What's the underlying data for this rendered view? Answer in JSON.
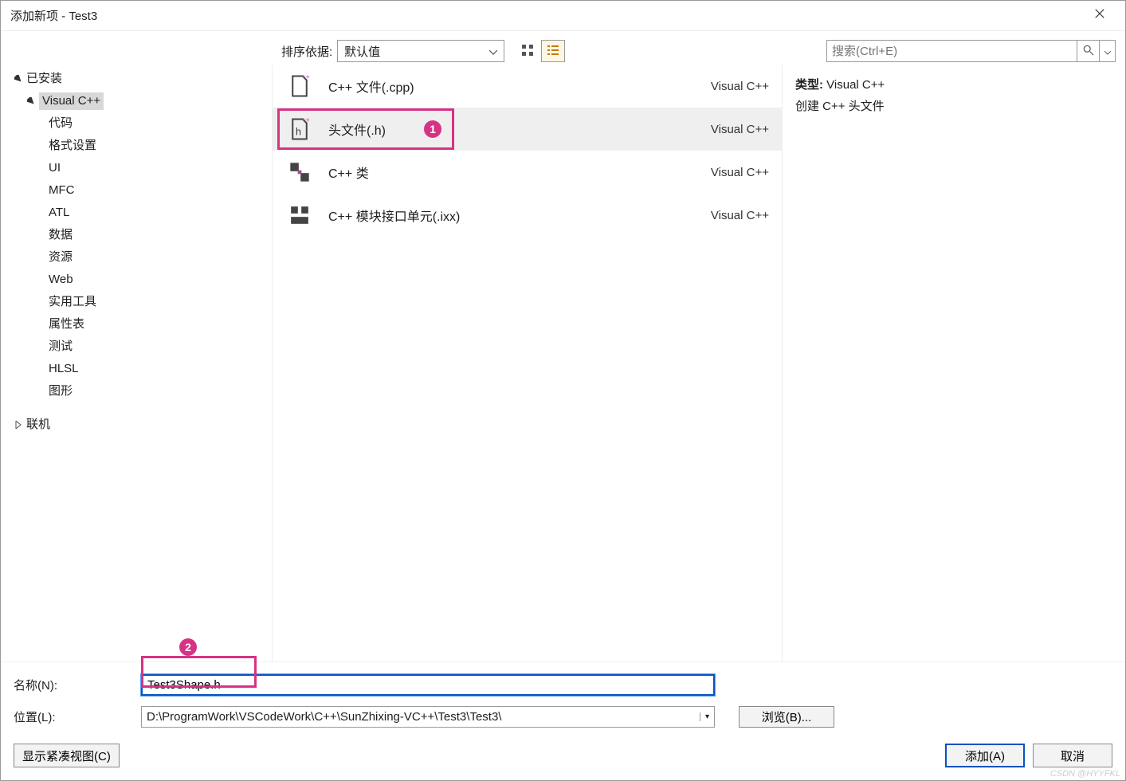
{
  "titlebar": {
    "title": "添加新项 - Test3"
  },
  "toprow": {
    "sort_label": "排序依据:",
    "sort_value": "默认值"
  },
  "search": {
    "placeholder": "搜索(Ctrl+E)"
  },
  "tree": {
    "installed": {
      "label": "已安装"
    },
    "visual_cpp": {
      "label": "Visual C++"
    },
    "items": [
      {
        "label": "代码"
      },
      {
        "label": "格式设置"
      },
      {
        "label": "UI"
      },
      {
        "label": "MFC"
      },
      {
        "label": "ATL"
      },
      {
        "label": "数据"
      },
      {
        "label": "资源"
      },
      {
        "label": "Web"
      },
      {
        "label": "实用工具"
      },
      {
        "label": "属性表"
      },
      {
        "label": "测试"
      },
      {
        "label": "HLSL"
      },
      {
        "label": "图形"
      }
    ],
    "online": {
      "label": "联机"
    }
  },
  "list": {
    "rows": [
      {
        "name": "C++ 文件(.cpp)",
        "lang": "Visual C++"
      },
      {
        "name": "头文件(.h)",
        "lang": "Visual C++",
        "selected": true
      },
      {
        "name": "C++ 类",
        "lang": "Visual C++"
      },
      {
        "name": "C++ 模块接口单元(.ixx)",
        "lang": "Visual C++"
      }
    ]
  },
  "details": {
    "type_label": "类型:",
    "type_value": "Visual C++",
    "desc": "创建 C++ 头文件"
  },
  "fields": {
    "name_label": "名称(N):",
    "name_value": "Test3Shape.h",
    "loc_label": "位置(L):",
    "loc_value": "D:\\ProgramWork\\VSCodeWork\\C++\\SunZhixing-VC++\\Test3\\Test3\\",
    "browse_label": "浏览(B)...",
    "compact_label": "显示紧凑视图(C)",
    "add_label": "添加(A)",
    "cancel_label": "取消"
  },
  "annotations": {
    "b1": "1",
    "b2": "2"
  },
  "watermark": "CSDN @HYYFKL"
}
